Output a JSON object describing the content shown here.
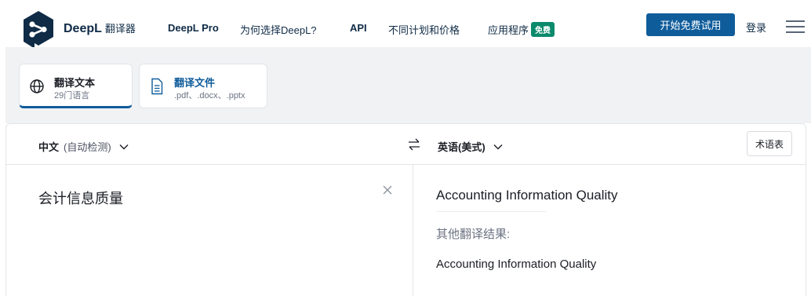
{
  "header": {
    "brand_name": "DeepL",
    "brand_sub": "翻译器",
    "nav": [
      {
        "label": "DeepL Pro"
      },
      {
        "label": "为何选择DeepL?"
      },
      {
        "label": "API"
      },
      {
        "label": "不同计划和价格"
      },
      {
        "label": "应用程序"
      }
    ],
    "apps_badge": "免费",
    "cta_label": "开始免费试用",
    "login_label": "登录"
  },
  "modes": {
    "text": {
      "title": "翻译文本",
      "subtitle": "29门语言"
    },
    "document": {
      "title": "翻译文件",
      "subtitle": ".pdf、.docx、.pptx"
    }
  },
  "translator": {
    "source_lang": "中文",
    "source_detect": "(自动检测)",
    "target_lang": "英语(美式)",
    "glossary_label": "术语表",
    "source_text": "会计信息质量",
    "target_text": "Accounting Information Quality",
    "alt_label": "其他翻译结果:",
    "alternatives": [
      "Accounting Information Quality"
    ]
  },
  "colors": {
    "brand_dark": "#0f2b46",
    "primary_blue": "#0f5c9b",
    "free_badge_green": "#0b8a6c",
    "mode_bar_bg": "#f1f2f4"
  }
}
